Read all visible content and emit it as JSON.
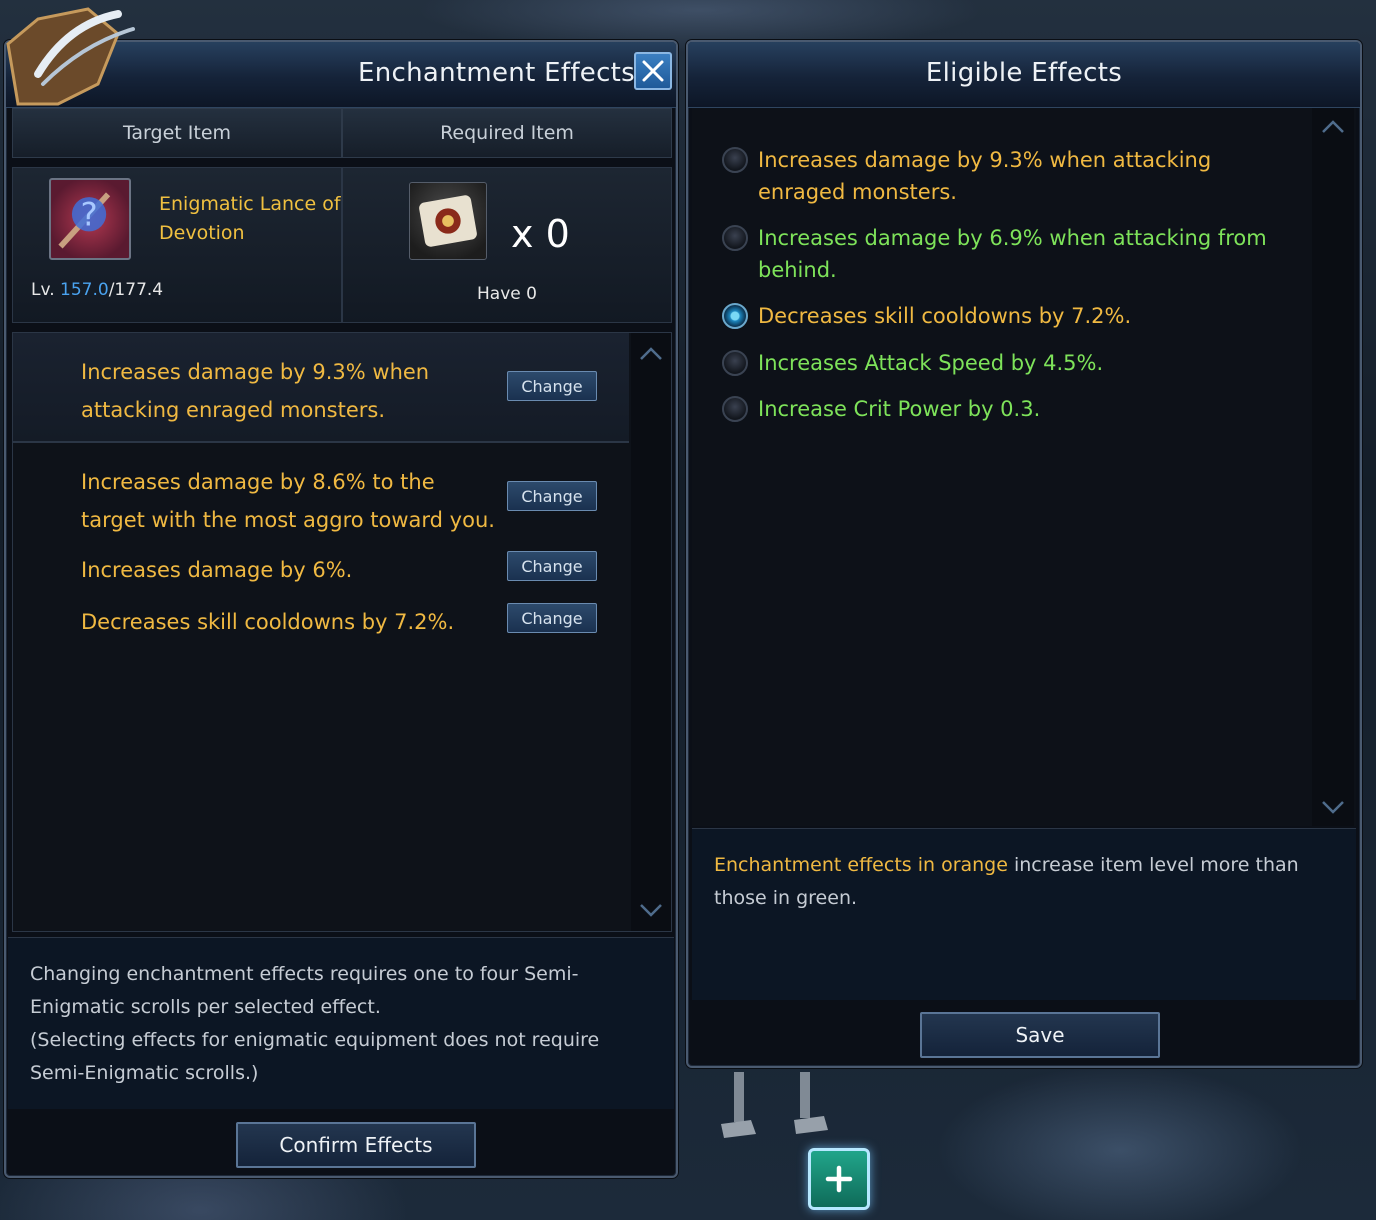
{
  "left_panel": {
    "title": "Enchantment Effects",
    "col_target": "Target Item",
    "col_required": "Required Item",
    "target_item": {
      "name": "Enigmatic Lance of Devotion",
      "level_prefix": "Lv.",
      "level_current": "157.0",
      "level_max": "/177.4"
    },
    "required_item": {
      "count": "x 0",
      "have": "Have 0"
    },
    "effects": [
      {
        "text": "Increases damage by 9.3% when attacking enraged monsters.",
        "button": "Change"
      },
      {
        "text": "Increases damage by 8.6% to the target with the most aggro toward you.",
        "button": "Change"
      },
      {
        "text": "Increases damage by 6%.",
        "button": "Change"
      },
      {
        "text": "Decreases skill cooldowns by 7.2%.",
        "button": "Change"
      }
    ],
    "info_line1": "Changing enchantment effects requires one to four Semi-Enigmatic scrolls per selected effect.",
    "info_line2": "(Selecting effects for enigmatic equipment does not require Semi-Enigmatic scrolls.)",
    "confirm_label": "Confirm Effects"
  },
  "right_panel": {
    "title": "Eligible Effects",
    "options": [
      {
        "text": "Increases damage by 9.3% when attacking enraged monsters.",
        "color": "orange",
        "selected": false
      },
      {
        "text": "Increases damage by 6.9% when attacking from behind.",
        "color": "green",
        "selected": false
      },
      {
        "text": "Decreases skill cooldowns by 7.2%.",
        "color": "orange",
        "selected": true
      },
      {
        "text": "Increases Attack Speed by 4.5%.",
        "color": "green",
        "selected": false
      },
      {
        "text": "Increase Crit Power by 0.3.",
        "color": "green",
        "selected": false
      }
    ],
    "hint_highlight": "Enchantment effects in orange",
    "hint_rest": " increase item level more than those in green.",
    "save_label": "Save"
  },
  "colors": {
    "orange": "#f0b942",
    "green": "#7ee35a",
    "level_blue": "#4aa3f0",
    "accent_blue": "#3b7fc2"
  },
  "icons": {
    "close": "close-icon",
    "plus": "plus-icon",
    "scroll_up": "chevron-up-icon",
    "scroll_down": "chevron-down-icon",
    "target_item": "mystery-weapon-icon",
    "required_item": "scroll-icon"
  }
}
